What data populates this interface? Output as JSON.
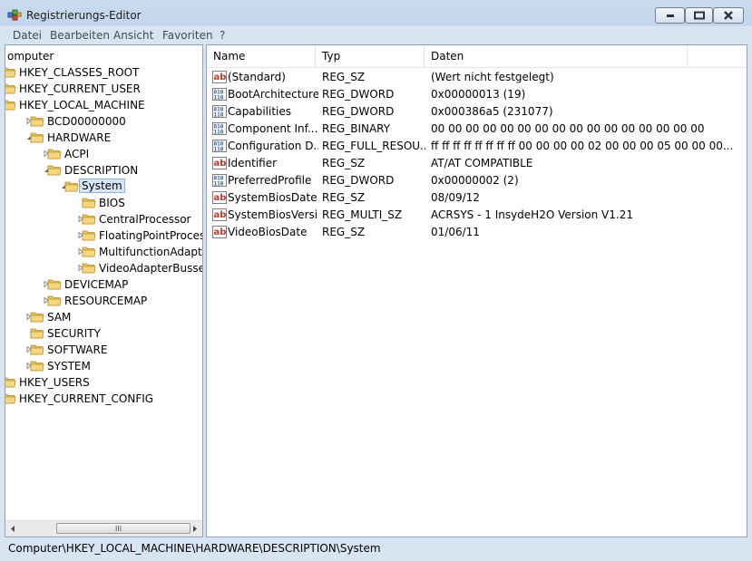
{
  "window": {
    "title": "Registrierungs-Editor"
  },
  "menu": [
    "Datei",
    "Bearbeiten",
    "Ansicht",
    "Favoriten",
    "?"
  ],
  "tree": [
    {
      "label": "omputer",
      "level": "root"
    },
    {
      "label": "HKEY_CLASSES_ROOT"
    },
    {
      "label": "HKEY_CURRENT_USER"
    },
    {
      "label": "HKEY_LOCAL_MACHINE"
    },
    {
      "label": "BCD00000000"
    },
    {
      "label": "HARDWARE"
    },
    {
      "label": "ACPI"
    },
    {
      "label": "DESCRIPTION"
    },
    {
      "label": "System",
      "selected": true
    },
    {
      "label": "BIOS"
    },
    {
      "label": "CentralProcessor"
    },
    {
      "label": "FloatingPointProcessor"
    },
    {
      "label": "MultifunctionAdapter"
    },
    {
      "label": "VideoAdapterBusses"
    },
    {
      "label": "DEVICEMAP"
    },
    {
      "label": "RESOURCEMAP"
    },
    {
      "label": "SAM"
    },
    {
      "label": "SECURITY"
    },
    {
      "label": "SOFTWARE"
    },
    {
      "label": "SYSTEM"
    },
    {
      "label": "HKEY_USERS"
    },
    {
      "label": "HKEY_CURRENT_CONFIG"
    }
  ],
  "scroll_grip": "III",
  "columns": {
    "name": "Name",
    "type": "Typ",
    "data": "Daten"
  },
  "values": [
    {
      "icon": "string-value-icon",
      "name": "(Standard)",
      "type": "REG_SZ",
      "data": "(Wert nicht festgelegt)"
    },
    {
      "icon": "binary-value-icon",
      "name": "BootArchitecture",
      "type": "REG_DWORD",
      "data": "0x00000013 (19)"
    },
    {
      "icon": "binary-value-icon",
      "name": "Capabilities",
      "type": "REG_DWORD",
      "data": "0x000386a5 (231077)"
    },
    {
      "icon": "binary-value-icon",
      "name": "Component Inf...",
      "type": "REG_BINARY",
      "data": "00 00 00 00 00 00 00 00 00 00 00 00 00 00 00 00"
    },
    {
      "icon": "binary-value-icon",
      "name": "Configuration D...",
      "type": "REG_FULL_RESOU...",
      "data": "ff ff ff ff ff ff ff ff 00 00 00 00 02 00 00 00 05 00 00 00..."
    },
    {
      "icon": "string-value-icon",
      "name": "Identifier",
      "type": "REG_SZ",
      "data": "AT/AT COMPATIBLE"
    },
    {
      "icon": "binary-value-icon",
      "name": "PreferredProfile",
      "type": "REG_DWORD",
      "data": "0x00000002 (2)"
    },
    {
      "icon": "string-value-icon",
      "name": "SystemBiosDate",
      "type": "REG_SZ",
      "data": "08/09/12"
    },
    {
      "icon": "string-value-icon",
      "name": "SystemBiosVersi...",
      "type": "REG_MULTI_SZ",
      "data": "ACRSYS - 1 InsydeH2O Version V1.21"
    },
    {
      "icon": "string-value-icon",
      "name": "VideoBiosDate",
      "type": "REG_SZ",
      "data": "01/06/11"
    }
  ],
  "status": "Computer\\HKEY_LOCAL_MACHINE\\HARDWARE\\DESCRIPTION\\System",
  "colors": {
    "selection": "#d9e6f8",
    "frame": "#c9dbef",
    "folder": "#e8c25a"
  }
}
